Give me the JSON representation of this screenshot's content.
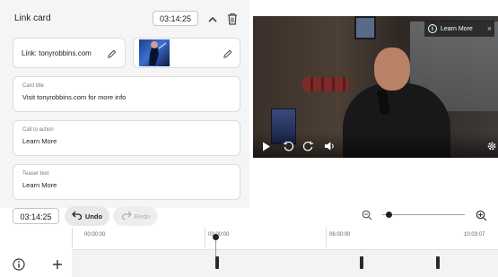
{
  "editor": {
    "title": "Link card",
    "time": "03:14:25",
    "link_text": "Link: tonyrobbins.com",
    "fields": [
      {
        "label": "Card title",
        "value": "Visit tonyrobbins.com for more info"
      },
      {
        "label": "Call to action",
        "value": "Learn More"
      },
      {
        "label": "Teaser text",
        "value": "Learn More"
      }
    ]
  },
  "video": {
    "teaser_label": "Learn More",
    "teaser_close": "×"
  },
  "toolbar": {
    "time": "03:14:25",
    "undo_label": "Undo",
    "redo_label": "Redo",
    "zoom_level": 0.05
  },
  "timeline": {
    "ruler_labels": [
      "00:00:00",
      "03:00:00",
      "06:00:00",
      "10:03:07"
    ],
    "info_icon": "i",
    "add_icon": "+"
  },
  "icons": {
    "chevron": "chevron-up-icon",
    "delete": "trash-icon",
    "edit": "pencil-icon",
    "undo": "undo-icon",
    "redo": "redo-icon",
    "zoom_out": "zoom-out-icon",
    "zoom_in": "zoom-in-icon",
    "play": "play-icon",
    "rewind": "rewind-10-icon",
    "forward": "forward-10-icon",
    "volume": "volume-icon",
    "settings": "settings-icon",
    "info": "info-icon",
    "add": "add-icon"
  },
  "colors": {
    "panel_bg": "#f5f5f5",
    "border": "#dadce0",
    "text": "#202124",
    "muted": "#7a7a7a",
    "disabled": "#b0b0b0"
  }
}
